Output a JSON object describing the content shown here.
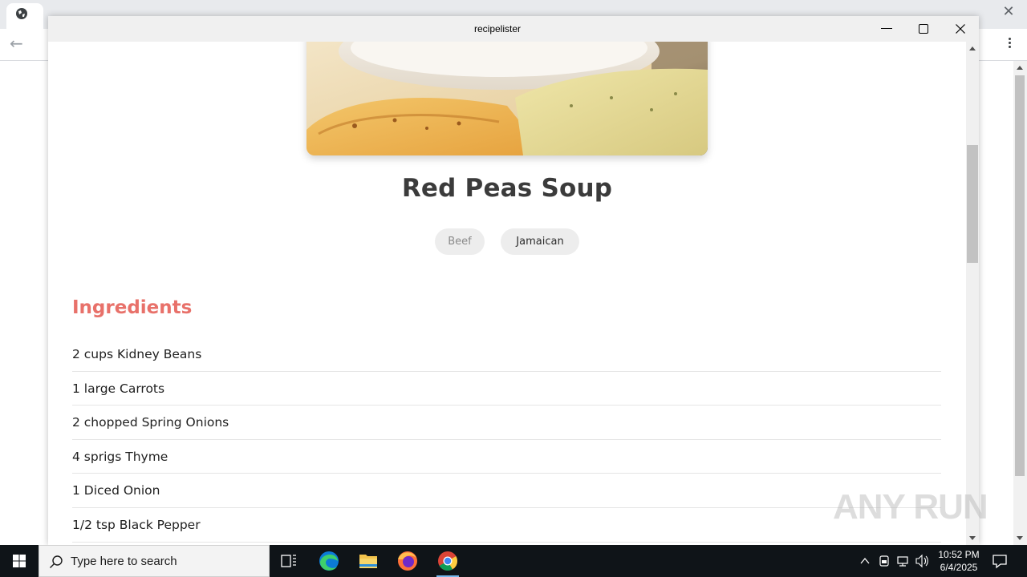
{
  "window": {
    "title": "recipelister"
  },
  "recipe": {
    "name": "Red Peas Soup",
    "tags": [
      "Beef",
      "Jamaican"
    ],
    "ingredients_heading": "Ingredients",
    "ingredients": [
      "2 cups Kidney Beans",
      "1 large Carrots",
      "2 chopped Spring Onions",
      "4 sprigs Thyme",
      "1 Diced Onion",
      "1/2 tsp Black Pepper"
    ]
  },
  "watermark": "ANY RUN",
  "taskbar": {
    "search_placeholder": "Type here to search",
    "time": "10:52 PM",
    "date": "6/4/2025",
    "pinned": [
      "task-view-icon",
      "edge-icon",
      "file-explorer-icon",
      "firefox-icon",
      "chrome-icon"
    ]
  },
  "colors": {
    "accent_heading": "#e8716a",
    "title_text": "#3b3b3b",
    "tag_background": "#ededed",
    "taskbar": "#0f1418"
  }
}
